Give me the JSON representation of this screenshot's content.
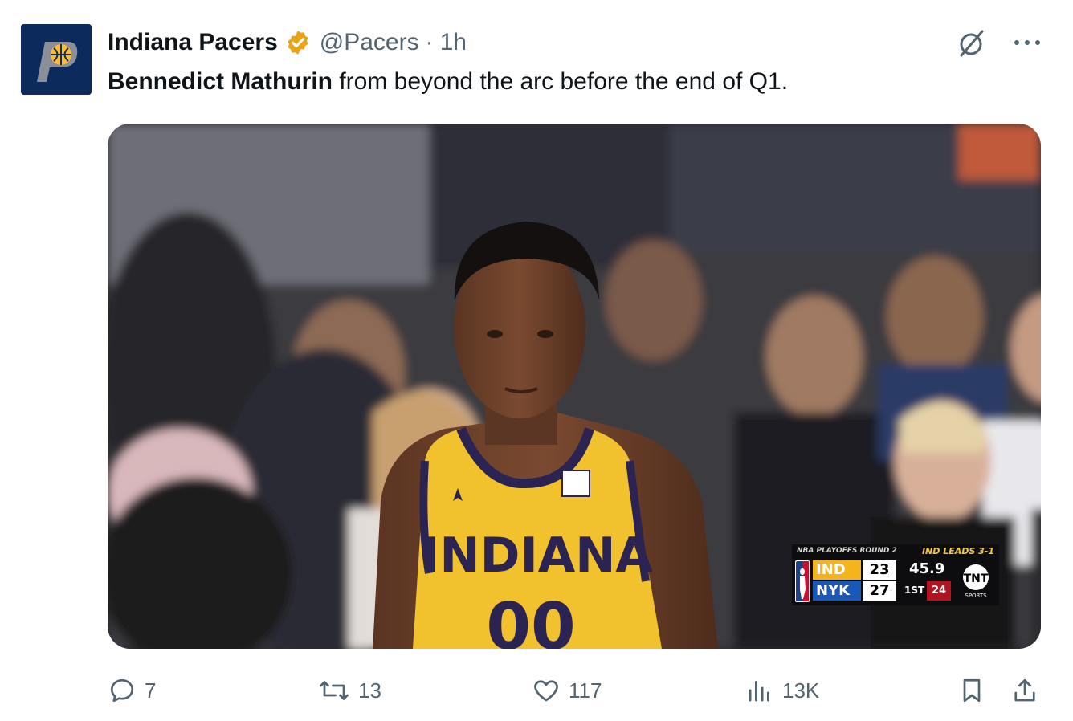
{
  "tweet": {
    "author_name": "Indiana Pacers",
    "handle": "@Pacers",
    "separator": "·",
    "time": "1h",
    "text_bold": "Bennedict Mathurin",
    "text_rest": " from beyond the arc before the end of Q1.",
    "verified_color": "#e8a317"
  },
  "top_actions": {
    "icons": [
      "grok-slash-icon",
      "more-options-icon"
    ],
    "more_label": "···"
  },
  "media": {
    "jersey_text": "INDIANA",
    "jersey_number": "00",
    "scorebug": {
      "header_left": "NBA PLAYOFFS ROUND 2",
      "header_right": "IND LEADS 3-1",
      "team1": "IND",
      "score1": "23",
      "team2": "NYK",
      "score2": "27",
      "clock": "45.9",
      "quarter": "1ST",
      "shot_clock": "24",
      "network": "TNT",
      "network_sub": "SPORTS"
    }
  },
  "actions": {
    "replies": "7",
    "reposts": "13",
    "likes": "117",
    "views": "13K"
  },
  "colors": {
    "text_primary": "#0f1419",
    "text_secondary": "#536471",
    "pacers_navy": "#0c2a5b",
    "pacers_gold": "#fdbb30"
  }
}
